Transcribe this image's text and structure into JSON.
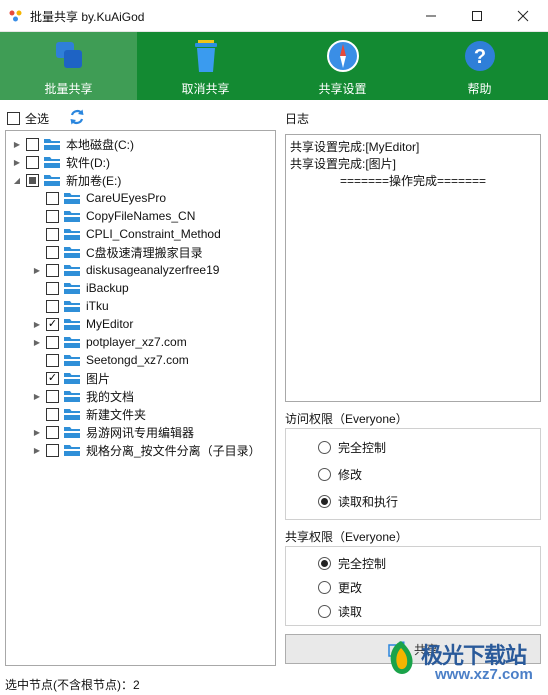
{
  "window": {
    "title": "批量共享 by.KuAiGod",
    "minimize": "—",
    "maximize": "☐",
    "close": "✕"
  },
  "toolbar": {
    "active_index": 0,
    "buttons": [
      {
        "label": "批量共享",
        "icon": "layers-icon"
      },
      {
        "label": "取消共享",
        "icon": "trash-icon"
      },
      {
        "label": "共享设置",
        "icon": "compass-icon"
      },
      {
        "label": "帮助",
        "icon": "help-icon"
      }
    ]
  },
  "select_all": {
    "label": "全选",
    "checked": false
  },
  "tree": {
    "nodes": [
      {
        "label": "本地磁盘(C:)",
        "level": 0,
        "expander": "▶",
        "state": "unchecked"
      },
      {
        "label": "软件(D:)",
        "level": 0,
        "expander": "▶",
        "state": "unchecked"
      },
      {
        "label": "新加卷(E:)",
        "level": 0,
        "expander": "◢",
        "state": "partial"
      },
      {
        "label": "CareUEyesPro",
        "level": 1,
        "expander": "",
        "state": "unchecked"
      },
      {
        "label": "CopyFileNames_CN",
        "level": 1,
        "expander": "",
        "state": "unchecked"
      },
      {
        "label": "CPLI_Constraint_Method",
        "level": 1,
        "expander": "",
        "state": "unchecked"
      },
      {
        "label": "C盘极速清理搬家目录",
        "level": 1,
        "expander": "",
        "state": "unchecked"
      },
      {
        "label": "diskusageanalyzerfree19",
        "level": 1,
        "expander": "▶",
        "state": "unchecked"
      },
      {
        "label": "iBackup",
        "level": 1,
        "expander": "",
        "state": "unchecked"
      },
      {
        "label": "iTku",
        "level": 1,
        "expander": "",
        "state": "unchecked"
      },
      {
        "label": "MyEditor",
        "level": 1,
        "expander": "▶",
        "state": "checked"
      },
      {
        "label": "potplayer_xz7.com",
        "level": 1,
        "expander": "▶",
        "state": "unchecked"
      },
      {
        "label": "Seetongd_xz7.com",
        "level": 1,
        "expander": "",
        "state": "unchecked"
      },
      {
        "label": "图片",
        "level": 1,
        "expander": "",
        "state": "checked"
      },
      {
        "label": "我的文档",
        "level": 1,
        "expander": "▶",
        "state": "unchecked"
      },
      {
        "label": "新建文件夹",
        "level": 1,
        "expander": "",
        "state": "unchecked"
      },
      {
        "label": "易游网讯专用编辑器",
        "level": 1,
        "expander": "▶",
        "state": "unchecked"
      },
      {
        "label": "规格分离_按文件分离（子目录）",
        "level": 1,
        "expander": "▶",
        "state": "unchecked"
      }
    ]
  },
  "log": {
    "title": "日志",
    "lines": [
      "共享设置完成:[MyEditor]",
      "共享设置完成:[图片]",
      "=======操作完成======="
    ]
  },
  "access": {
    "title": "访问权限（Everyone）",
    "options": [
      "完全控制",
      "修改",
      "读取和执行"
    ],
    "selected": 2
  },
  "share_perm": {
    "title": "共享权限（Everyone）",
    "options": [
      "完全控制",
      "更改",
      "读取"
    ],
    "selected": 0
  },
  "share_button": {
    "label": "共享"
  },
  "status": {
    "text": "选中节点(不含根节点)：2"
  },
  "watermark": {
    "title": "极光下载站",
    "url": "www.xz7.com"
  },
  "colors": {
    "toolbar": "#138a32",
    "toolbar_active": "#3f9d55",
    "folder": "#2f8fd8"
  }
}
